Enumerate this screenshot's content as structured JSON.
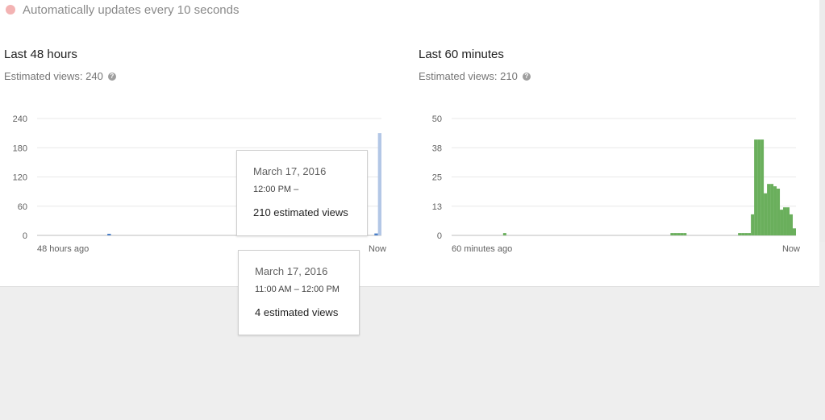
{
  "status": {
    "text": "Automatically updates every 10 seconds",
    "dot_color": "#ef9a9a"
  },
  "panel_48h": {
    "title": "Last 48 hours",
    "estimated_views": "Estimated views: 240",
    "help_icon": "help-icon"
  },
  "panel_60m": {
    "title": "Last 60 minutes",
    "estimated_views": "Estimated views: 210",
    "help_icon": "help-icon"
  },
  "chart_data": [
    {
      "type": "bar",
      "title": "Last 48 hours",
      "y_ticks": [
        "240",
        "180",
        "120",
        "60",
        "0"
      ],
      "ylim": [
        0,
        240
      ],
      "x_start_label": "48 hours ago",
      "x_end_label": "Now",
      "bar_color": "#4a7fc8",
      "highlight_color": "#b3c7e6",
      "grid": true,
      "values": [
        0,
        0,
        0,
        0,
        0,
        0,
        0,
        0,
        0,
        0,
        0,
        0,
        0,
        0,
        0,
        0,
        0,
        0,
        0,
        0,
        2,
        0,
        0,
        0,
        0,
        0,
        0,
        0,
        0,
        0,
        0,
        0,
        0,
        0,
        0,
        0,
        0,
        0,
        0,
        0,
        0,
        0,
        0,
        0,
        0,
        0,
        0,
        0,
        0,
        0,
        0,
        0,
        0,
        0,
        0,
        0,
        0,
        0,
        0,
        0,
        0,
        0,
        0,
        0,
        0,
        0,
        2,
        0,
        0,
        0,
        0,
        0,
        0,
        0,
        0,
        0,
        0,
        0,
        0,
        0,
        0,
        0,
        0,
        0,
        0,
        0,
        0,
        0,
        0,
        0,
        0,
        0,
        0,
        0,
        0,
        0,
        4,
        210
      ],
      "highlighted_index": 97
    },
    {
      "type": "bar",
      "title": "Last 60 minutes",
      "y_ticks": [
        "50",
        "38",
        "25",
        "13",
        "0"
      ],
      "ylim": [
        0,
        50
      ],
      "x_start_label": "60 minutes ago",
      "x_end_label": "Now",
      "bar_color": "#6aaf5c",
      "grid": true,
      "values": [
        0,
        0,
        0,
        0,
        0,
        0,
        0,
        0,
        0,
        0,
        0,
        0,
        0,
        0,
        0,
        0,
        1,
        0,
        0,
        0,
        0,
        0,
        0,
        0,
        0,
        0,
        0,
        0,
        0,
        0,
        0,
        0,
        0,
        0,
        0,
        0,
        0,
        0,
        0,
        0,
        0,
        0,
        0,
        0,
        0,
        0,
        0,
        0,
        0,
        0,
        0,
        0,
        0,
        0,
        0,
        0,
        0,
        0,
        0,
        0,
        0,
        0,
        0,
        0,
        0,
        0,
        0,
        0,
        1,
        1,
        1,
        1,
        1,
        0,
        0,
        0,
        0,
        0,
        0,
        0,
        0,
        0,
        0,
        0,
        0,
        0,
        0,
        0,
        0,
        1,
        1,
        1,
        1,
        9,
        41,
        41,
        41,
        18,
        22,
        22,
        21,
        20,
        11,
        12,
        12,
        9,
        3
      ]
    }
  ],
  "tooltip_top": {
    "date": "March 17, 2016",
    "time": "12:00 PM –",
    "views": "210 estimated views"
  },
  "tooltip_bottom": {
    "date": "March 17, 2016",
    "time": "11:00 AM – 12:00 PM",
    "views": "4 estimated views"
  }
}
